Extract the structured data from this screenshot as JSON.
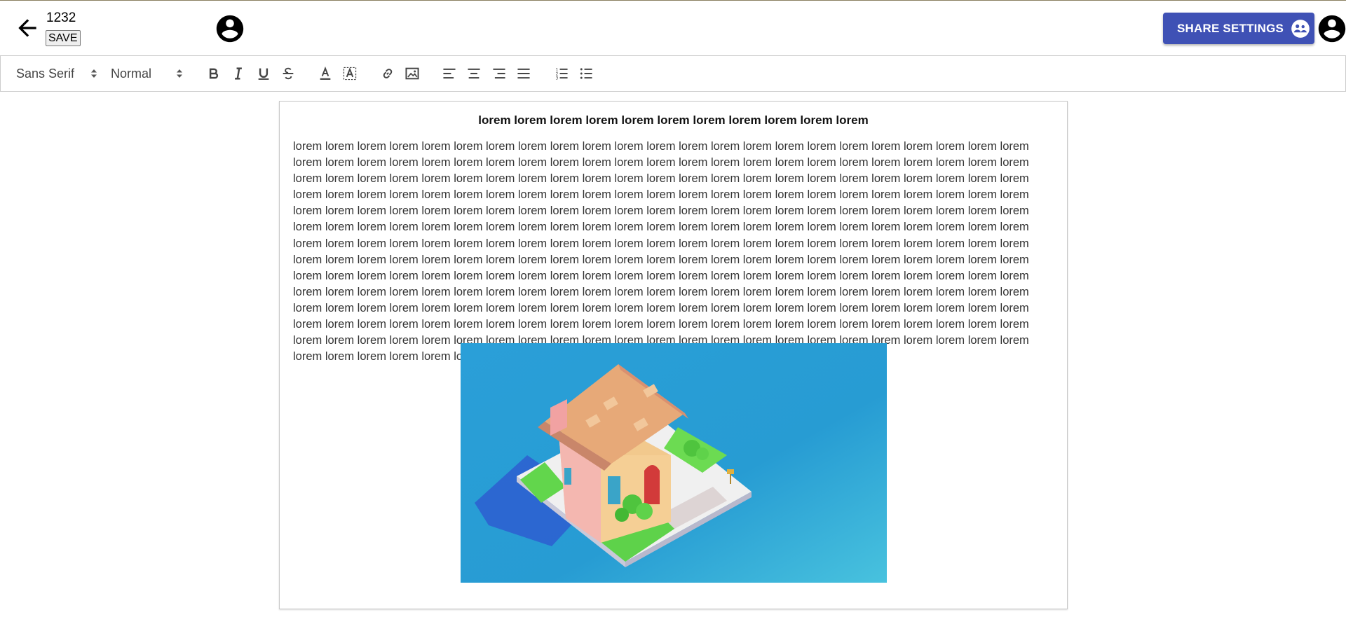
{
  "header": {
    "doc_id": "1232",
    "save_label": "SAVE",
    "share_label": "SHARE SETTINGS",
    "accent_color": "#3f51b5"
  },
  "toolbar": {
    "font_family": "Sans Serif",
    "font_size": "Normal",
    "buttons": [
      "bold-icon",
      "italic-icon",
      "underline-icon",
      "strikethrough-icon",
      "text-color-icon",
      "highlight-icon",
      "link-icon",
      "image-icon",
      "align-left-icon",
      "align-center-icon",
      "align-right-icon",
      "align-justify-icon",
      "ordered-list-icon",
      "bullet-list-icon"
    ]
  },
  "document": {
    "title": "lorem lorem lorem lorem lorem lorem lorem lorem lorem lorem lorem",
    "body": "lorem lorem lorem lorem lorem lorem lorem lorem lorem lorem lorem lorem lorem lorem lorem lorem lorem lorem lorem lorem lorem lorem lorem lorem lorem lorem lorem lorem lorem lorem lorem lorem lorem lorem lorem lorem lorem lorem lorem lorem lorem lorem lorem lorem lorem lorem lorem lorem lorem lorem lorem lorem lorem lorem lorem lorem lorem lorem lorem lorem lorem lorem lorem lorem lorem lorem lorem lorem lorem lorem lorem lorem lorem lorem lorem lorem lorem lorem lorem lorem lorem lorem lorem lorem lorem lorem lorem lorem lorem lorem lorem lorem lorem lorem lorem lorem lorem lorem lorem lorem lorem lorem lorem lorem lorem lorem lorem lorem lorem lorem lorem lorem lorem lorem lorem lorem lorem lorem lorem lorem lorem lorem lorem lorem lorem lorem lorem lorem lorem lorem lorem lorem lorem lorem lorem lorem lorem lorem lorem lorem lorem lorem lorem lorem lorem lorem lorem lorem lorem lorem lorem lorem lorem lorem lorem lorem lorem lorem lorem lorem lorem lorem lorem lorem lorem lorem lorem lorem lorem lorem lorem lorem lorem lorem lorem lorem lorem lorem lorem lorem lorem lorem lorem lorem lorem lorem lorem lorem lorem lorem lorem lorem lorem lorem lorem lorem lorem lorem lorem lorem lorem lorem lorem lorem lorem lorem lorem lorem lorem lorem lorem lorem lorem lorem lorem lorem lorem lorem lorem lorem lorem lorem lorem lorem lorem lorem lorem lorem lorem lorem lorem lorem lorem lorem lorem lorem lorem lorem lorem lorem lorem lorem lorem lorem lorem lorem lorem lorem lorem lorem lorem lorem lorem lorem lorem lorem lorem lorem lorem lorem lorem lorem lorem lorem lorem lorem lorem lorem lorem lorem lorem lorem lorem lorem lorem lorem lorem lorem lorem lorem lorem lorem lorem lorem lorem lorem lorem lorem lorem lorem lorem lorem lorem lorem lorem lorem lorem lorem lorem lorem lorem lorem lorem lorem lorem lorem lorem",
    "image_icon": "isometric-house-illustration"
  }
}
